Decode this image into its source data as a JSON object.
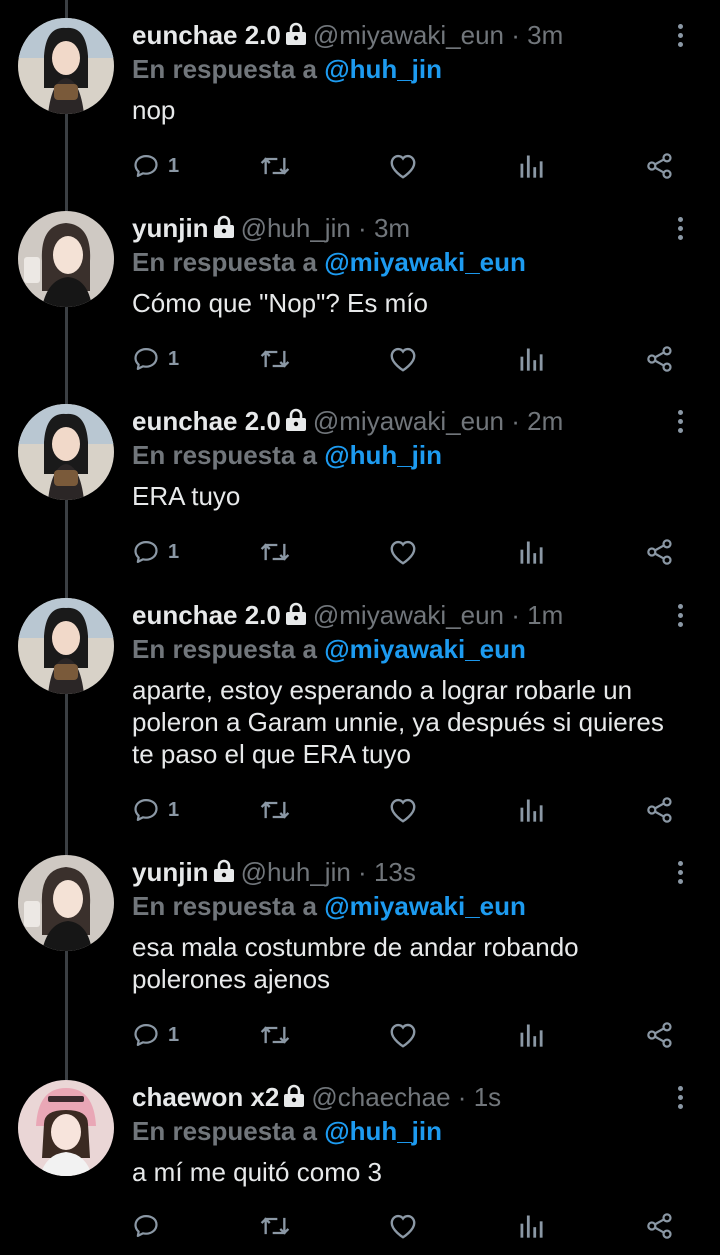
{
  "tweets": [
    {
      "name": "eunchae 2.0",
      "handle": "@miyawaki_eun",
      "time": "3m",
      "reply_prefix": "En respuesta a",
      "reply_to": "@huh_jin",
      "text": "nop",
      "reply_count": "1",
      "avatar": "avatar-eunchae"
    },
    {
      "name": "yunjin",
      "handle": "@huh_jin",
      "time": "3m",
      "reply_prefix": "En respuesta a",
      "reply_to": "@miyawaki_eun",
      "text": "Cómo que \"Nop\"? Es mío",
      "reply_count": "1",
      "avatar": "avatar-yunjin"
    },
    {
      "name": "eunchae 2.0",
      "handle": "@miyawaki_eun",
      "time": "2m",
      "reply_prefix": "En respuesta a",
      "reply_to": "@huh_jin",
      "text": "ERA tuyo",
      "reply_count": "1",
      "avatar": "avatar-eunchae"
    },
    {
      "name": "eunchae 2.0",
      "handle": "@miyawaki_eun",
      "time": "1m",
      "reply_prefix": "En respuesta a",
      "reply_to": "@miyawaki_eun",
      "text": "aparte, estoy esperando a lograr robarle un poleron a Garam unnie, ya después si quieres te paso el que ERA tuyo",
      "reply_count": "1",
      "avatar": "avatar-eunchae"
    },
    {
      "name": "yunjin",
      "handle": "@huh_jin",
      "time": "13s",
      "reply_prefix": "En respuesta a",
      "reply_to": "@miyawaki_eun",
      "text": "esa mala costumbre de andar robando polerones ajenos",
      "reply_count": "1",
      "avatar": "avatar-yunjin"
    },
    {
      "name": "chaewon x2",
      "handle": "@chaechae",
      "time": "1s",
      "reply_prefix": "En respuesta a",
      "reply_to": "@huh_jin",
      "text": "a mí me quitó como 3",
      "reply_count": "",
      "avatar": "avatar-chaewon"
    }
  ],
  "separator": "·",
  "icons": [
    "reply-icon",
    "retweet-icon",
    "like-icon",
    "views-icon",
    "share-icon",
    "lock-icon",
    "more-icon"
  ],
  "colors": {
    "background": "#000000",
    "mention": "#1d9bf0",
    "muted": "#71767b",
    "text": "#e7e9ea"
  }
}
